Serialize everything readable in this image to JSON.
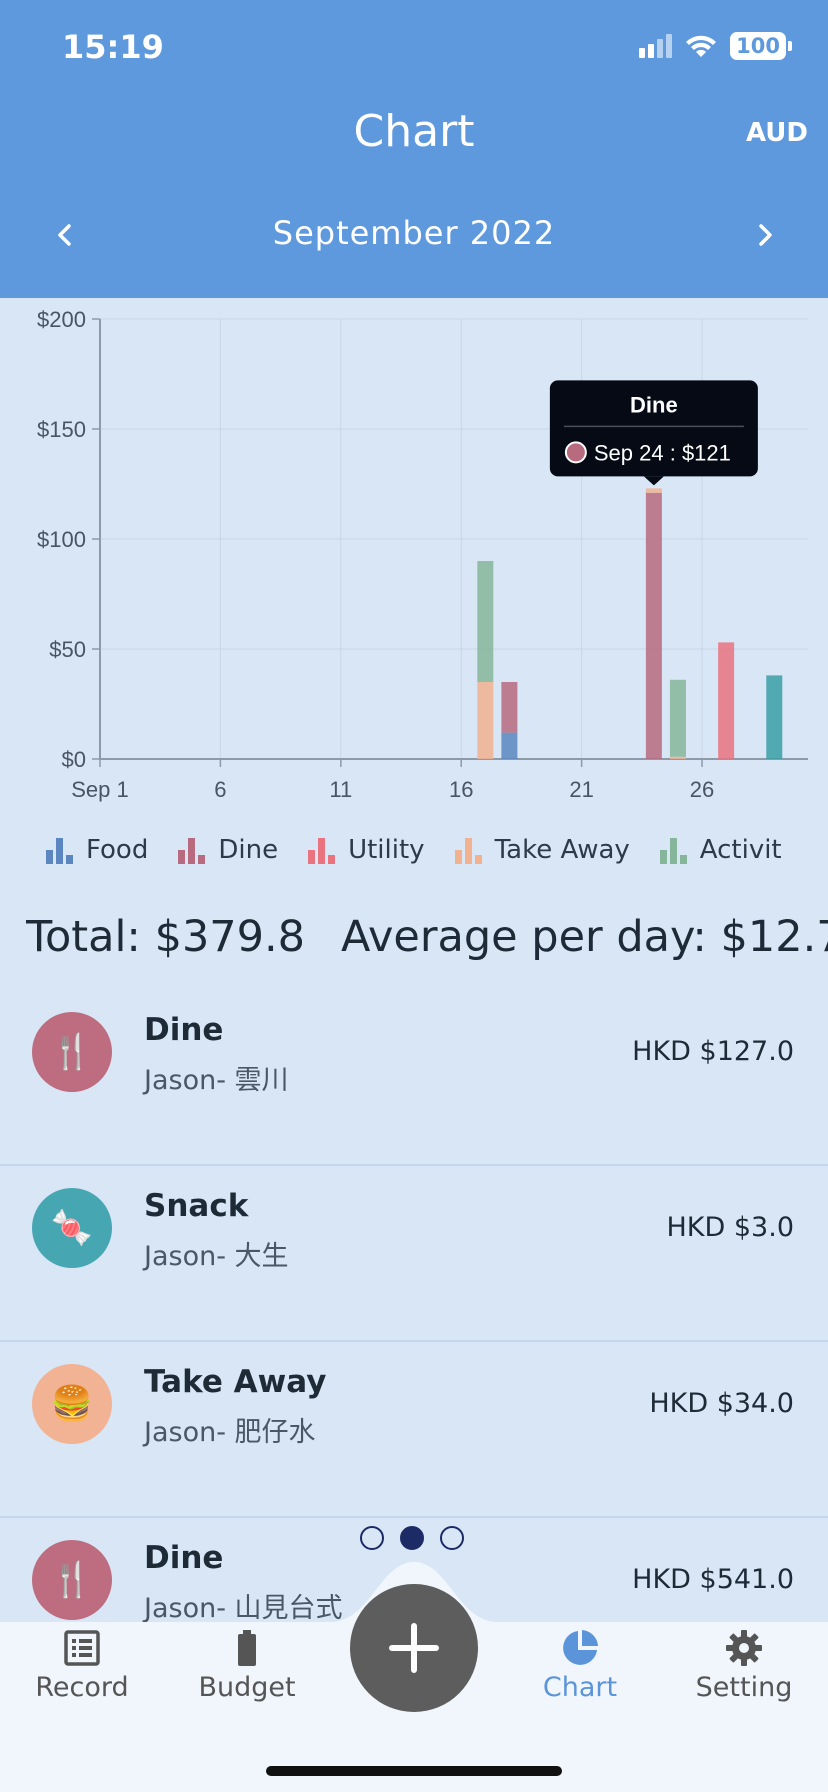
{
  "status_bar": {
    "time": "15:19",
    "battery": "100"
  },
  "header": {
    "title": "Chart",
    "currency": "AUD",
    "month": "September 2022"
  },
  "chart_data": {
    "type": "bar",
    "stacked": true,
    "x_ticks": [
      "Sep 1",
      "6",
      "11",
      "16",
      "21",
      "26"
    ],
    "x_tick_days": [
      1,
      6,
      11,
      16,
      21,
      26
    ],
    "y_ticks": [
      "$0",
      "$50",
      "$100",
      "$150",
      "$200"
    ],
    "ylim": [
      0,
      200
    ],
    "xlim": [
      1,
      30
    ],
    "grid": true,
    "legend_position": "bottom",
    "series": [
      {
        "name": "Food",
        "color": "#5b86bf",
        "points": [
          {
            "day": 18,
            "value": 12
          }
        ]
      },
      {
        "name": "Dine",
        "color": "#b86a7e",
        "points": [
          {
            "day": 18,
            "value": 23
          },
          {
            "day": 24,
            "value": 121
          }
        ]
      },
      {
        "name": "Utility",
        "color": "#e9737f",
        "points": [
          {
            "day": 27,
            "value": 53
          }
        ]
      },
      {
        "name": "Take Away",
        "color": "#f2b18f",
        "points": [
          {
            "day": 17,
            "value": 35
          },
          {
            "day": 24,
            "value": 2
          },
          {
            "day": 25,
            "value": 1
          }
        ]
      },
      {
        "name": "Activit",
        "color": "#86b69a",
        "points": [
          {
            "day": 17,
            "value": 55
          },
          {
            "day": 25,
            "value": 35
          }
        ]
      },
      {
        "name": "",
        "color": "#3a9ea6",
        "points": [
          {
            "day": 29,
            "value": 38
          }
        ]
      }
    ],
    "tooltip": {
      "title": "Dine",
      "text": "Sep 24 : $121",
      "color": "#b86a7e",
      "day": 24,
      "value": 123
    }
  },
  "legend": [
    {
      "label": "Food",
      "color": "#5b86bf"
    },
    {
      "label": "Dine",
      "color": "#b86a7e"
    },
    {
      "label": "Utility",
      "color": "#e9737f"
    },
    {
      "label": "Take Away",
      "color": "#f2b18f"
    },
    {
      "label": "Activit",
      "color": "#86b69a"
    }
  ],
  "summary": {
    "total": "Total: $379.8",
    "average": "Average per day: $12.7"
  },
  "records": [
    {
      "title": "Dine",
      "subtitle": "Jason- 雲川",
      "amount": "HKD $127.0",
      "icon": "fork-knife-icon",
      "glyph": "🍴",
      "color": "#bd6d7f"
    },
    {
      "title": "Snack",
      "subtitle": "Jason- 大生",
      "amount": "HKD $3.0",
      "icon": "candy-icon",
      "glyph": "🍬",
      "color": "#46a6b2"
    },
    {
      "title": "Take Away",
      "subtitle": "Jason- 肥仔水",
      "amount": "HKD $34.0",
      "icon": "burger-icon",
      "glyph": "🍔",
      "color": "#f2b294"
    },
    {
      "title": "Dine",
      "subtitle": "Jason- 山見台式",
      "amount": "HKD $541.0",
      "icon": "fork-knife-icon",
      "glyph": "🍴",
      "color": "#bd6d7f"
    }
  ],
  "nav": {
    "record": "Record",
    "budget": "Budget",
    "chart": "Chart",
    "setting": "Setting",
    "active_color": "#5b94d8"
  }
}
